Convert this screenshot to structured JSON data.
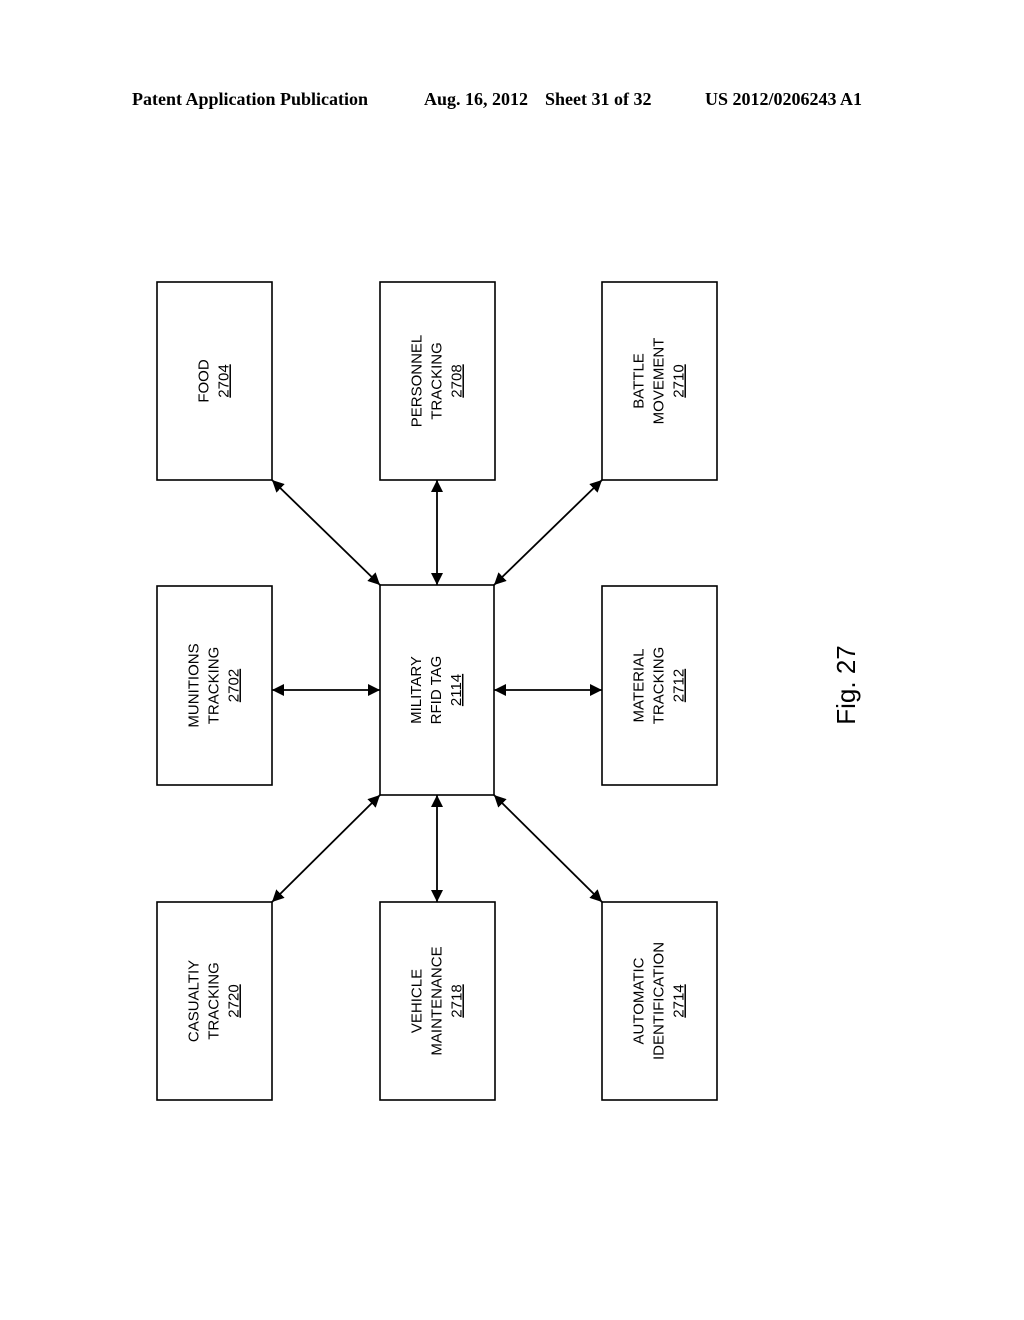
{
  "header": {
    "publication": "Patent Application Publication",
    "date": "Aug. 16, 2012",
    "sheet": "Sheet 31 of 32",
    "number": "US 2012/0206243 A1"
  },
  "figure_label": "Fig. 27",
  "center": {
    "id": "military-rfid-tag",
    "lines": [
      "MILITARY",
      "RFID TAG"
    ],
    "ref": "2114"
  },
  "boxes": [
    {
      "id": "food",
      "lines": [
        "FOOD"
      ],
      "ref": "2704",
      "pos": "top-left"
    },
    {
      "id": "personnel-tracking",
      "lines": [
        "PERSONNEL",
        "TRACKING"
      ],
      "ref": "2708",
      "pos": "top-center"
    },
    {
      "id": "battle-movement",
      "lines": [
        "BATTLE",
        "MOVEMENT"
      ],
      "ref": "2710",
      "pos": "top-right"
    },
    {
      "id": "munitions-tracking",
      "lines": [
        "MUNITIONS",
        "TRACKING"
      ],
      "ref": "2702",
      "pos": "middle-left"
    },
    {
      "id": "material-tracking",
      "lines": [
        "MATERIAL",
        "TRACKING"
      ],
      "ref": "2712",
      "pos": "middle-right"
    },
    {
      "id": "casualtiy-tracking",
      "lines": [
        "CASUALTIY",
        "TRACKING"
      ],
      "ref": "2720",
      "pos": "bottom-left"
    },
    {
      "id": "vehicle-maintenance",
      "lines": [
        "VEHICLE",
        "MAINTENANCE"
      ],
      "ref": "2718",
      "pos": "bottom-center"
    },
    {
      "id": "automatic-identification",
      "lines": [
        "AUTOMATIC",
        "IDENTIFICATION"
      ],
      "ref": "2714",
      "pos": "bottom-right"
    }
  ],
  "connections": [
    {
      "from": "military-rfid-tag",
      "to": "food",
      "bidirectional": true
    },
    {
      "from": "military-rfid-tag",
      "to": "personnel-tracking",
      "bidirectional": true
    },
    {
      "from": "military-rfid-tag",
      "to": "battle-movement",
      "bidirectional": true
    },
    {
      "from": "military-rfid-tag",
      "to": "munitions-tracking",
      "bidirectional": true
    },
    {
      "from": "military-rfid-tag",
      "to": "material-tracking",
      "bidirectional": true
    },
    {
      "from": "military-rfid-tag",
      "to": "casualtiy-tracking",
      "bidirectional": true
    },
    {
      "from": "military-rfid-tag",
      "to": "vehicle-maintenance",
      "bidirectional": true
    },
    {
      "from": "military-rfid-tag",
      "to": "automatic-identification",
      "bidirectional": true
    }
  ]
}
